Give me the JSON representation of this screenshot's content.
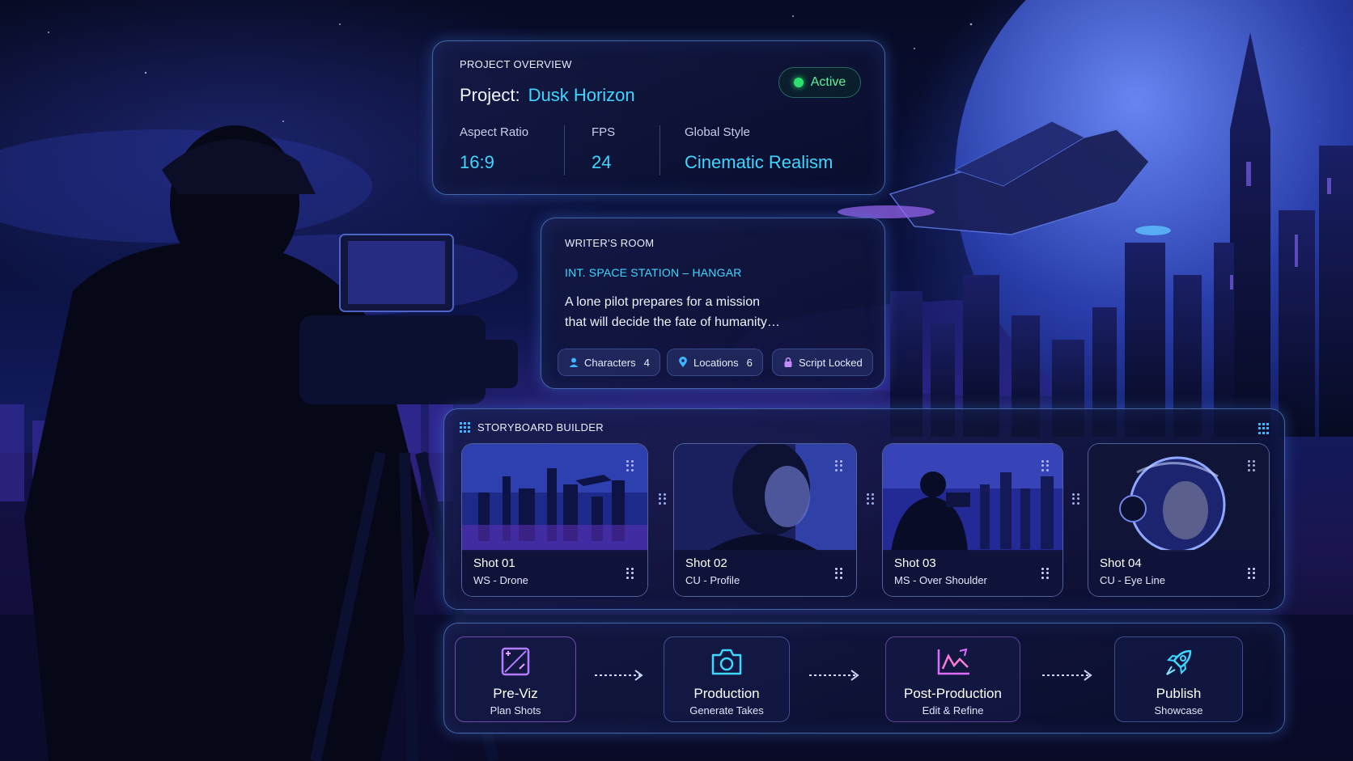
{
  "overview": {
    "heading": "PROJECT OVERVIEW",
    "project_label": "Project:",
    "project_name": "Dusk Horizon",
    "status": "Active",
    "stats": [
      {
        "label": "Aspect Ratio",
        "value": "16:9"
      },
      {
        "label": "FPS",
        "value": "24"
      },
      {
        "label": "Global Style",
        "value": "Cinematic Realism"
      }
    ]
  },
  "writers_room": {
    "heading": "WRITER'S ROOM",
    "scene_heading": "INT. SPACE STATION – HANGAR",
    "logline_1": "A lone pilot prepares for a mission",
    "logline_2": "that will decide the fate of humanity…",
    "chips": [
      {
        "label": "Characters",
        "count": "4",
        "icon": "person-icon"
      },
      {
        "label": "Locations",
        "count": "6",
        "icon": "location-pin-icon"
      },
      {
        "label": "Script Locked",
        "count": "",
        "icon": "lock-icon"
      }
    ]
  },
  "storyboard": {
    "heading": "STORYBOARD BUILDER",
    "shots": [
      {
        "title": "Shot 01",
        "desc": "WS - Drone",
        "image": "futuristic-city-drone-shot"
      },
      {
        "title": "Shot 02",
        "desc": "CU - Profile",
        "image": "woman-profile-closeup"
      },
      {
        "title": "Shot 03",
        "desc": "MS - Over Shoulder",
        "image": "cameraman-over-shoulder"
      },
      {
        "title": "Shot 04",
        "desc": "CU - Eye Line",
        "image": "astronaut-helmet-closeup"
      }
    ]
  },
  "pipeline": {
    "stages": [
      {
        "title": "Pre-Viz",
        "subtitle": "Plan Shots",
        "icon": "storyboard-frame-icon",
        "color": "#b57cff"
      },
      {
        "title": "Production",
        "subtitle": "Generate Takes",
        "icon": "camera-icon",
        "color": "#3fd6ff"
      },
      {
        "title": "Post-Production",
        "subtitle": "Edit & Refine",
        "icon": "graph-edit-icon",
        "color": "#e06cff"
      },
      {
        "title": "Publish",
        "subtitle": "Showcase",
        "icon": "rocket-icon",
        "color": "#3fd6ff"
      }
    ]
  },
  "colors": {
    "accent": "#3fd6ff",
    "active": "#2ee06d",
    "border": "#6eaaff"
  }
}
